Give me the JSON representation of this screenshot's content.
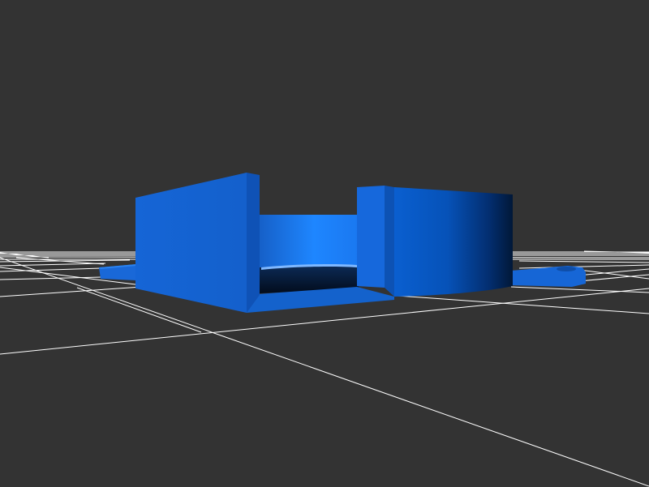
{
  "scene": {
    "background_color": "#333333",
    "grid_line_color": "#ffffff",
    "model_color": "#1a6fe0",
    "model_shadow_color": "#001a3a",
    "description_hidden": ""
  }
}
